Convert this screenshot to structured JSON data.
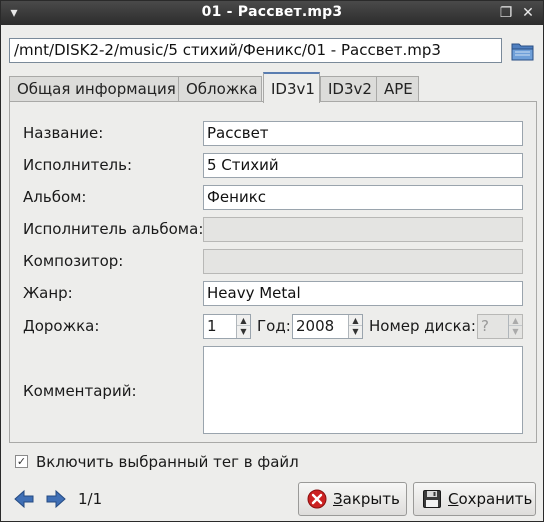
{
  "window": {
    "title": "01 - Рассвет.mp3"
  },
  "path": {
    "value": "/mnt/DISK2-2/music/5 стихий/Феникс/01 - Рассвет.mp3"
  },
  "tabs": [
    {
      "label": "Общая информация",
      "active": false
    },
    {
      "label": "Обложка",
      "active": false
    },
    {
      "label": "ID3v1",
      "active": true
    },
    {
      "label": "ID3v2",
      "active": false
    },
    {
      "label": "APE",
      "active": false
    }
  ],
  "form": {
    "title_label": "Название:",
    "title_value": "Рассвет",
    "artist_label": "Исполнитель:",
    "artist_value": "5 Стихий",
    "album_label": "Альбом:",
    "album_value": "Феникс",
    "album_artist_label": "Исполнитель альбома:",
    "album_artist_value": "",
    "composer_label": "Композитор:",
    "composer_value": "",
    "genre_label": "Жанр:",
    "genre_value": "Heavy Metal",
    "track_label": "Дорожка:",
    "track_value": "1",
    "year_label": "Год:",
    "year_value": "2008",
    "disc_label": "Номер диска:",
    "disc_value": "?",
    "comment_label": "Комментарий:",
    "comment_value": ""
  },
  "include_tag": {
    "label": "Включить выбранный тег в файл",
    "checked": true,
    "mark": "✓"
  },
  "nav": {
    "counter": "1/1"
  },
  "buttons": {
    "close_mnemonic": "З",
    "close_rest": "акрыть",
    "save_mnemonic": "С",
    "save_rest": "охранить"
  },
  "icons": {
    "window_menu": "chevron-down-icon",
    "maximize": "restore-icon",
    "close": "close-icon",
    "folder": "folder-open-icon",
    "prev": "arrow-left-icon",
    "next": "arrow-right-icon",
    "close_button": "stop-icon",
    "save_button": "floppy-disk-icon"
  },
  "colors": {
    "accent": "#5a7db0",
    "close_icon": "#cc2222",
    "nav_arrow": "#3f6fb5"
  }
}
